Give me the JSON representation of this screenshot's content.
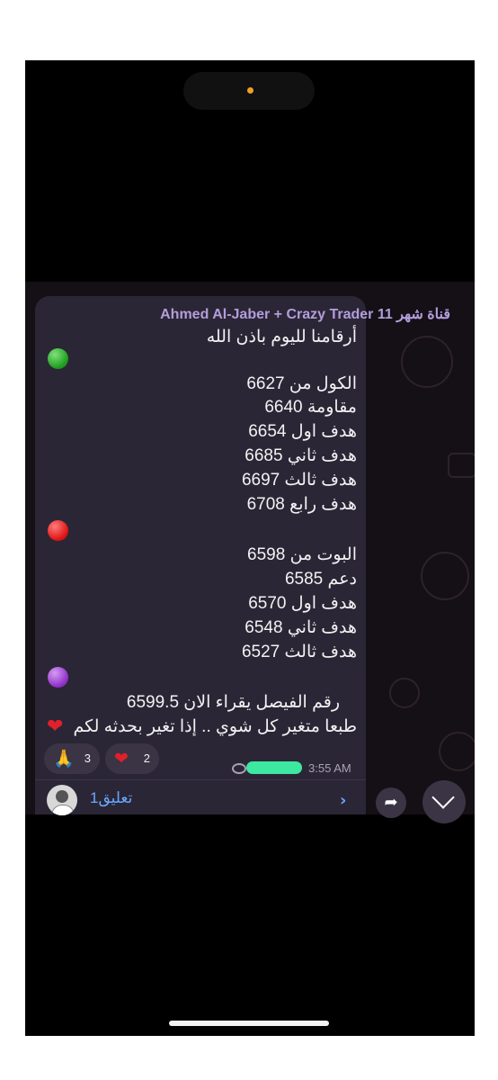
{
  "message": {
    "sender": "Ahmed Al-Jaber + Crazy Trader 11 قناة شهر",
    "lines": [
      "أرقامنا لليوم باذن الله",
      "الكول من 6627",
      "مقاومة 6640",
      "هدف اول 6654",
      "هدف ثاني 6685",
      "هدف ثالث 6697",
      "هدف رابع 6708",
      "البوت من 6598",
      "دعم 6585",
      "هدف اول 6570",
      "هدف ثاني 6548",
      "هدف ثالث 6527",
      "رقم الفيصل يقراء الان  6599.5",
      "طبعا متغير كل شوي .. إذا تغير بحدثه لكم"
    ],
    "time": "3:55 AM",
    "reactions": [
      {
        "icon": "🙏",
        "count": "3"
      },
      {
        "icon": "❤",
        "count": "2"
      }
    ],
    "comments_label": "1تعليق"
  }
}
